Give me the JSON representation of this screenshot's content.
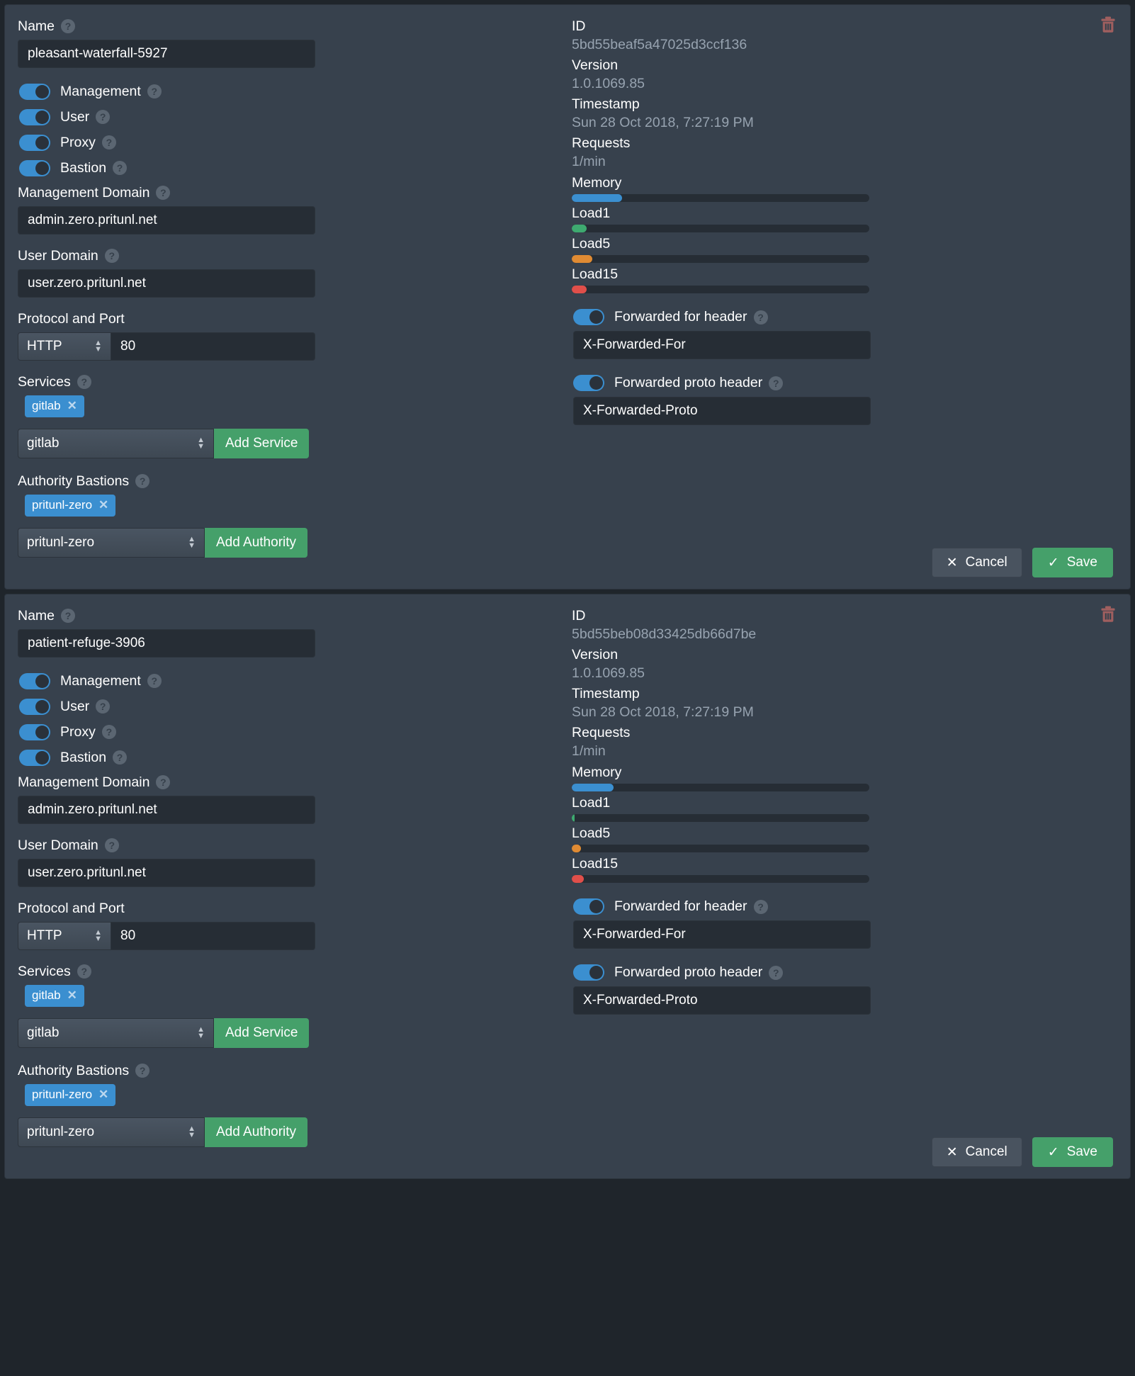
{
  "colors": {
    "panel_bg": "#37414d",
    "input_bg": "#262d35",
    "accent_blue": "#3b8fd0",
    "accent_green": "#45a06a",
    "trash_red": "#a05f5f",
    "meter_memory": "#3b8fd0",
    "meter_load1": "#3eaa70",
    "meter_load5": "#e08b33",
    "meter_load15": "#e04f4a"
  },
  "common": {
    "help_glyph": "?",
    "close_glyph": "✕",
    "check_glyph": "✓",
    "spin_up": "▲",
    "spin_down": "▼",
    "name_label": "Name",
    "management_domain_label": "Management Domain",
    "user_domain_label": "User Domain",
    "protocol_port_label": "Protocol and Port",
    "services_label": "Services",
    "authority_bastions_label": "Authority Bastions",
    "add_service_label": "Add Service",
    "add_authority_label": "Add Authority",
    "cancel_label": "Cancel",
    "save_label": "Save",
    "id_label": "ID",
    "version_label": "Version",
    "timestamp_label": "Timestamp",
    "requests_label": "Requests",
    "memory_label": "Memory",
    "load1_label": "Load1",
    "load5_label": "Load5",
    "load15_label": "Load15",
    "forwarded_for_label": "Forwarded for header",
    "forwarded_proto_label": "Forwarded proto header",
    "toggles": [
      {
        "label": "Management",
        "on": true
      },
      {
        "label": "User",
        "on": true
      },
      {
        "label": "Proxy",
        "on": true
      },
      {
        "label": "Bastion",
        "on": true
      }
    ]
  },
  "panels": [
    {
      "name_value": "pleasant-waterfall-5927",
      "management_domain_value": "admin.zero.pritunl.net",
      "user_domain_value": "user.zero.pritunl.net",
      "protocol_selected": "HTTP",
      "port_value": "80",
      "service_chip": "gitlab",
      "service_select": "gitlab",
      "authority_chip": "pritunl-zero",
      "authority_select": "pritunl-zero",
      "id_value": "5bd55beaf5a47025d3ccf136",
      "version_value": "1.0.1069.85",
      "timestamp_value": "Sun 28 Oct 2018, 7:27:19 PM",
      "requests_value": "1/min",
      "memory_pct": 17,
      "load1_pct": 5,
      "load5_pct": 7,
      "load15_pct": 5,
      "forwarded_for_on": true,
      "forwarded_for_value": "X-Forwarded-For",
      "forwarded_proto_on": true,
      "forwarded_proto_value": "X-Forwarded-Proto"
    },
    {
      "name_value": "patient-refuge-3906",
      "management_domain_value": "admin.zero.pritunl.net",
      "user_domain_value": "user.zero.pritunl.net",
      "protocol_selected": "HTTP",
      "port_value": "80",
      "service_chip": "gitlab",
      "service_select": "gitlab",
      "authority_chip": "pritunl-zero",
      "authority_select": "pritunl-zero",
      "id_value": "5bd55beb08d33425db66d7be",
      "version_value": "1.0.1069.85",
      "timestamp_value": "Sun 28 Oct 2018, 7:27:19 PM",
      "requests_value": "1/min",
      "memory_pct": 14,
      "load1_pct": 1,
      "load5_pct": 3,
      "load15_pct": 4,
      "forwarded_for_on": true,
      "forwarded_for_value": "X-Forwarded-For",
      "forwarded_proto_on": true,
      "forwarded_proto_value": "X-Forwarded-Proto"
    }
  ]
}
